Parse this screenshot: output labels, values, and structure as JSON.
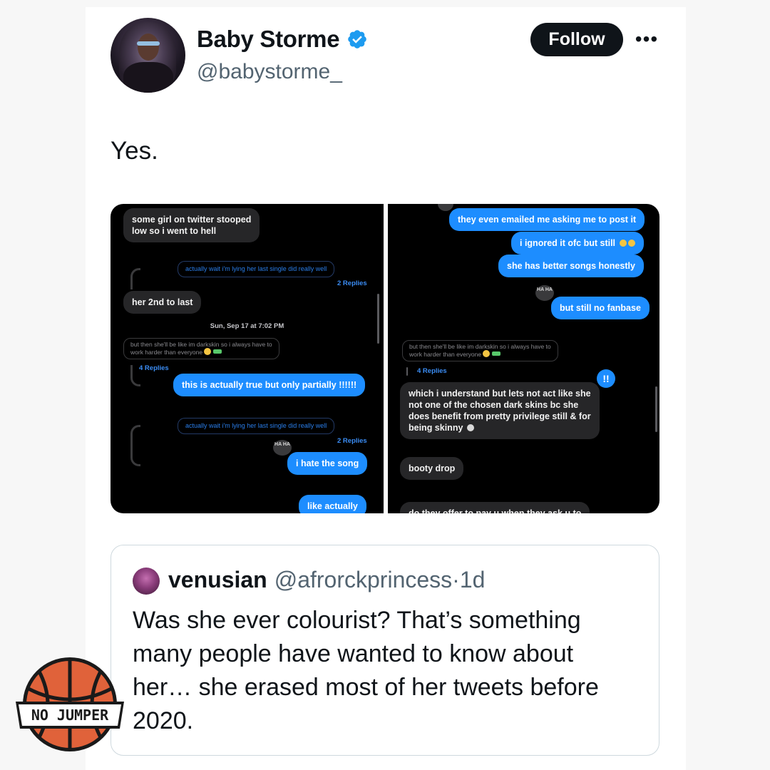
{
  "post": {
    "display_name": "Baby Storme",
    "handle": "@babystorme_",
    "follow_label": "Follow",
    "more_label": "•••",
    "text": "Yes.",
    "verified_color": "#1d9bf0"
  },
  "screenshots": {
    "left": {
      "msg1_line1": "some girl on twitter stooped",
      "msg1_line2": "low so i went to hell",
      "reply_pill_1": "actually wait i'm lying her last single did really well",
      "reply_count_1": "2 Replies",
      "msg2": "her 2nd to last",
      "timestamp": "Sun, Sep 17 at 7:02 PM",
      "quoted_line1": "but then she'll be like im darkskin so i always have to",
      "quoted_line2": "work harder than everyone",
      "reply_count_2": "4 Replies",
      "msg3": "this is actually true but only partially !!!!!!",
      "reply_pill_2": "actually wait i'm lying her last single did really well",
      "reply_count_3": "2 Replies",
      "tapback": "HA HA",
      "msg4": "i hate the song",
      "msg5": "like actually"
    },
    "right": {
      "msg1": "they even emailed me asking me to post it",
      "msg2": "i ignored it ofc but still",
      "msg3": "she has better songs honestly",
      "tapback": "HA HA",
      "msg4": "but still no fanbase",
      "quoted_line1": "but then she'll be like im darkskin so i always have to",
      "quoted_line2": "work harder than everyone",
      "reply_count": "4 Replies",
      "excl": "!!",
      "msg5_line1": "which i understand but lets not act like she",
      "msg5_line2": "not one of the chosen dark skins bc she",
      "msg5_line3": "does benefit from pretty privilege still & for",
      "msg5_line4": "being skinny",
      "msg6": "booty drop",
      "msg7": "do they offer to pay u when they ask u to"
    }
  },
  "quote": {
    "name": "venusian",
    "handle": "@afrorckprincess",
    "separator": "·",
    "time": "1d",
    "text": "Was she ever colourist? That’s something many people have wanted to know about her… she erased most of her tweets before 2020."
  },
  "watermark": {
    "text": "NO JUMPER"
  }
}
